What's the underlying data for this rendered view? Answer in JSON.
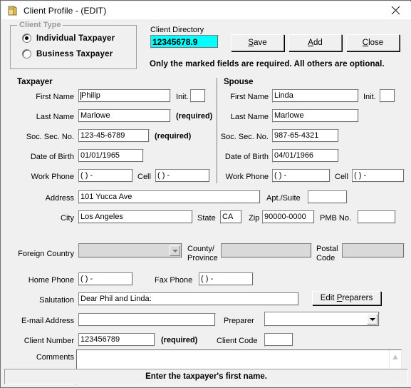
{
  "window": {
    "title": "Client Profile - (EDIT)",
    "icon": "folder-icon",
    "close_glyph": "✕"
  },
  "client_type": {
    "legend": "Client Type",
    "options": [
      {
        "label": "Individual Taxpayer",
        "selected": true
      },
      {
        "label": "Business Taxpayer",
        "selected": false
      }
    ]
  },
  "client_directory": {
    "label": "Client Directory",
    "value": "12345678.9",
    "highlight_color": "#00ffff"
  },
  "buttons": {
    "save": "Save",
    "add": "Add",
    "close": "Close",
    "edit_preparers": "Edit Preparers"
  },
  "required_note": "Only the marked fields are required.  All others are optional.",
  "required_tag": "(required)",
  "taxpayer": {
    "heading": "Taxpayer",
    "first_name": {
      "label": "First Name",
      "value": "Philip"
    },
    "init": {
      "label": "Init.",
      "value": ""
    },
    "last_name": {
      "label": "Last Name",
      "value": "Marlowe"
    },
    "ssn": {
      "label": "Soc. Sec. No.",
      "value": "123-45-6789"
    },
    "dob": {
      "label": "Date of Birth",
      "value": "01/01/1965"
    },
    "work_phone": {
      "label": "Work Phone",
      "value": "(   )    -"
    },
    "cell": {
      "label": "Cell",
      "value": "(   )    -"
    }
  },
  "spouse": {
    "heading": "Spouse",
    "first_name": {
      "label": "First Name",
      "value": "Linda"
    },
    "init": {
      "label": "Init.",
      "value": ""
    },
    "last_name": {
      "label": "Last Name",
      "value": "Marlowe"
    },
    "ssn": {
      "label": "Soc. Sec. No.",
      "value": "987-65-4321"
    },
    "dob": {
      "label": "Date of Birth",
      "value": "04/01/1966"
    },
    "work_phone": {
      "label": "Work Phone",
      "value": "(   )    -"
    },
    "cell": {
      "label": "Cell",
      "value": "(   )    -"
    }
  },
  "address_block": {
    "address": {
      "label": "Address",
      "value": "101 Yucca Ave"
    },
    "apt_suite": {
      "label": "Apt./Suite",
      "value": ""
    },
    "city": {
      "label": "City",
      "value": "Los Angeles"
    },
    "state": {
      "label": "State",
      "value": "CA"
    },
    "zip": {
      "label": "Zip",
      "value": "90000-0000"
    },
    "pmb_no": {
      "label": "PMB No.",
      "value": ""
    },
    "foreign_country": {
      "label": "Foreign Country",
      "value": ""
    },
    "county_province": {
      "label_line1": "County/",
      "label_line2": "Province",
      "value": ""
    },
    "postal_code": {
      "label_line1": "Postal",
      "label_line2": "Code",
      "value": ""
    }
  },
  "contact_block": {
    "home_phone": {
      "label": "Home Phone",
      "value": "(   )    -"
    },
    "fax_phone": {
      "label": "Fax Phone",
      "value": "(   )    -"
    },
    "salutation": {
      "label": "Salutation",
      "value": "Dear Phil and Linda:"
    },
    "email": {
      "label": "E-mail Address",
      "value": ""
    },
    "preparer": {
      "label": "Preparer",
      "value": ""
    },
    "client_number": {
      "label": "Client Number",
      "value": "123456789"
    },
    "client_code": {
      "label": "Client Code",
      "value": ""
    },
    "comments": {
      "label": "Comments",
      "value": ""
    }
  },
  "statusbar": {
    "message": "Enter the taxpayer's first name."
  }
}
